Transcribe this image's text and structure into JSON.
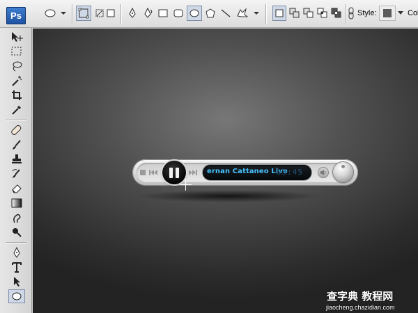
{
  "app": {
    "logo_text": "Ps"
  },
  "options_bar": {
    "style_label": "Style:",
    "color_label": "Col"
  },
  "player": {
    "track_title": "ernan Cattaneo Live",
    "time": "03:45"
  },
  "watermark": {
    "title": "查字典 教程网",
    "url": "jiaocheng.chazidian.com"
  }
}
